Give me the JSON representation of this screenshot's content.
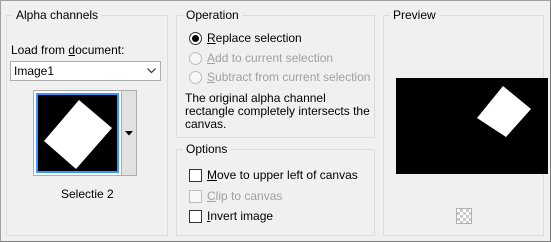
{
  "alpha_channels": {
    "title": "Alpha channels",
    "load_label_pre": "Load from ",
    "load_label_u": "d",
    "load_label_post": "ocument:",
    "document_value": "Image1",
    "selection_name": "Selectie 2"
  },
  "operation": {
    "title": "Operation",
    "options": [
      {
        "u": "R",
        "rest": "eplace selection",
        "checked": true,
        "enabled": true
      },
      {
        "u": "A",
        "rest": "dd to current selection",
        "checked": false,
        "enabled": false
      },
      {
        "u": "S",
        "rest": "ubtract from current selection",
        "checked": false,
        "enabled": false
      }
    ],
    "description": "The original alpha channel rectangle completely intersects the canvas."
  },
  "options": {
    "title": "Options",
    "items": [
      {
        "u": "M",
        "rest": "ove to upper left of canvas",
        "checked": false,
        "enabled": true
      },
      {
        "u": "C",
        "rest": "lip to canvas",
        "checked": false,
        "enabled": false
      },
      {
        "u": "I",
        "rest": "nvert image",
        "checked": false,
        "enabled": true
      }
    ]
  },
  "preview": {
    "title": "Preview",
    "icon": "checkerboard-icon"
  }
}
